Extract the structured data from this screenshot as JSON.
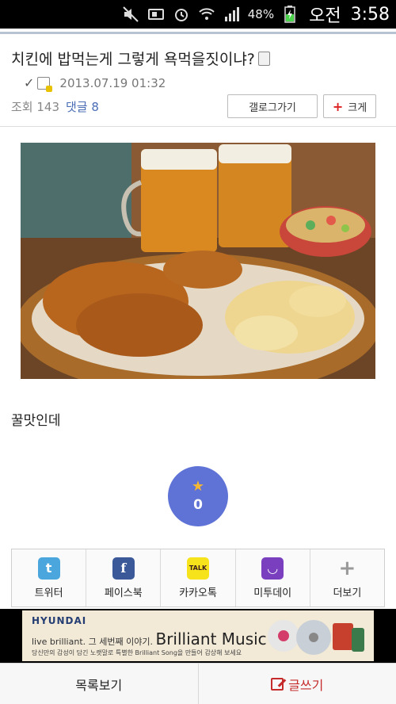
{
  "status_bar": {
    "battery": "48%",
    "ampm": "오전",
    "time": "3:58"
  },
  "post": {
    "title": "치킨에 밥먹는게 그렇게 욕먹을짓이냐?",
    "datetime": "2013.07.19 01:32",
    "views": "조회 143",
    "comments": "댓글 8",
    "body": "꿀맛인데"
  },
  "buttons": {
    "gallery": "갤로그가기",
    "enlarge": "크게",
    "enlarge_symbol": "+"
  },
  "recommend": {
    "count": "0"
  },
  "share": [
    {
      "label": "트위터",
      "icon": "twitter-icon",
      "glyph": "t"
    },
    {
      "label": "페이스북",
      "icon": "facebook-icon",
      "glyph": "f"
    },
    {
      "label": "카카오톡",
      "icon": "kakaotalk-icon",
      "glyph": "TALK"
    },
    {
      "label": "미투데이",
      "icon": "metoday-icon",
      "glyph": "◡"
    },
    {
      "label": "더보기",
      "icon": "more-icon",
      "glyph": "+"
    }
  ],
  "ad": {
    "brand": "HYUNDAI",
    "line1": "live brilliant. 그 세번째 이야기.",
    "line1_big": "Brilliant Music",
    "line2": "당신만의 감성이 담긴 노랫말로 특별한 Brilliant Song을 만들어 감상해 보세요"
  },
  "bottom": {
    "list": "목록보기",
    "write": "글쓰기"
  },
  "colors": {
    "accent": "#5f72d6",
    "comments_link": "#4a6db5",
    "write_red": "#c52b2b"
  }
}
